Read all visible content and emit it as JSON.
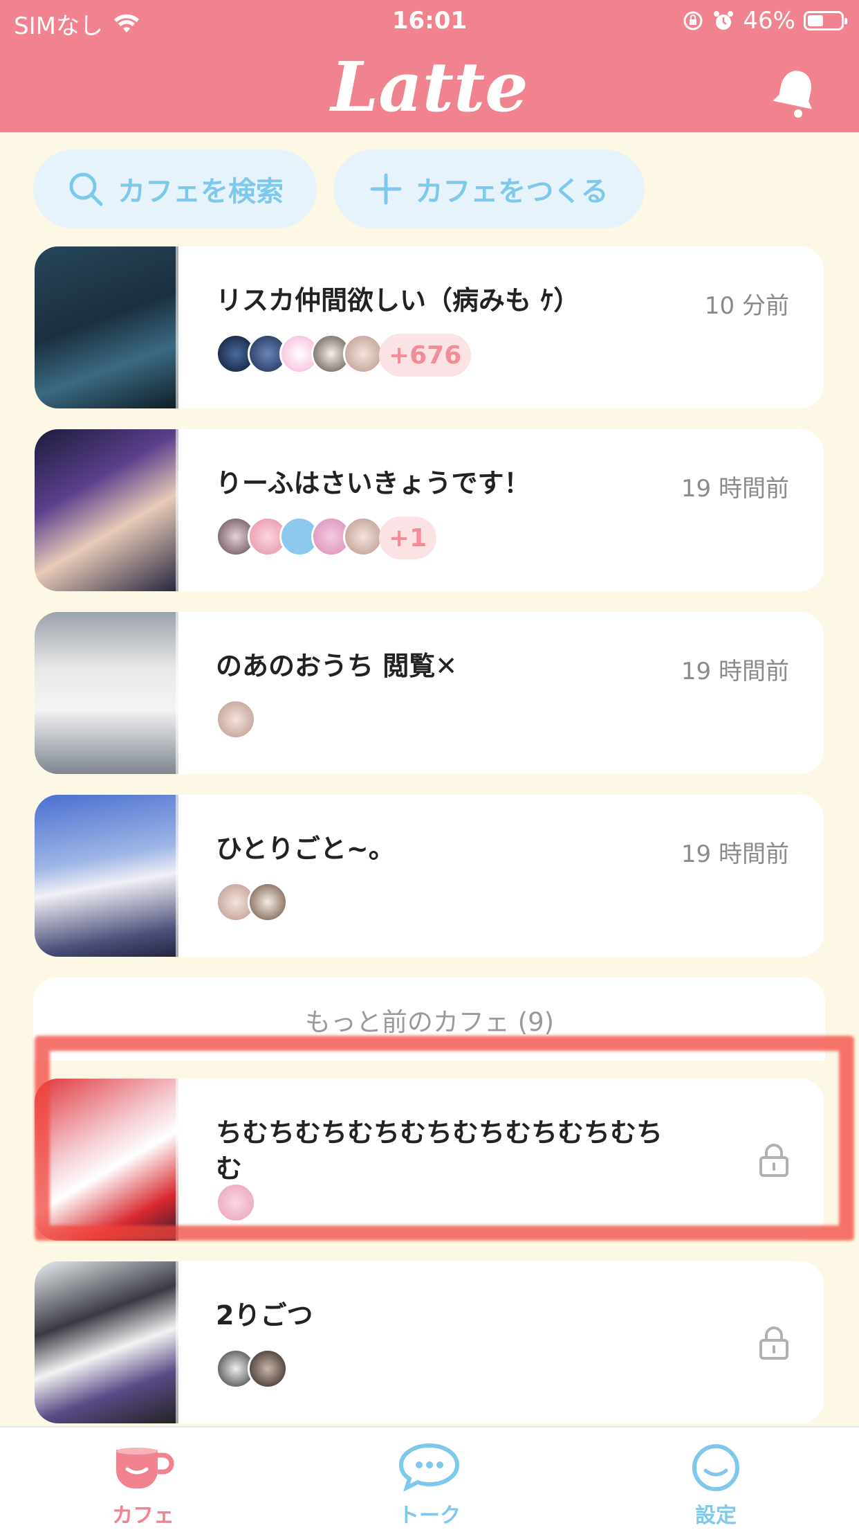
{
  "status_bar": {
    "carrier": "SIMなし",
    "time": "16:01",
    "battery": "46%"
  },
  "header": {
    "logo": "Latte"
  },
  "actions": {
    "search_label": "カフェを検索",
    "create_label": "カフェをつくる"
  },
  "cafes": [
    {
      "title": "リスカ仲間欲しい（病みも ｹ）",
      "time": "10 分前",
      "more": "+676"
    },
    {
      "title": "りーふはさいきょうです！",
      "time": "19 時間前",
      "more": "+1"
    },
    {
      "title": "のあのおうち 閲覧✕",
      "time": "19 時間前"
    },
    {
      "title": "ひとりごと~。",
      "time": "19 時間前"
    }
  ],
  "older": {
    "label": "もっと前のカフェ (9)",
    "items": [
      {
        "title": "ちむちむちむちむちむちむちむちむちむ",
        "locked": true
      },
      {
        "title": "2りごつ",
        "locked": true
      }
    ]
  },
  "tabbar": {
    "cafe_label": "カフェ",
    "talk_label": "トーク",
    "settings_label": "設定"
  },
  "colors": {
    "brand": "#f0838f",
    "accent_blue": "#7ec8ec",
    "background": "#fdf8e6"
  }
}
